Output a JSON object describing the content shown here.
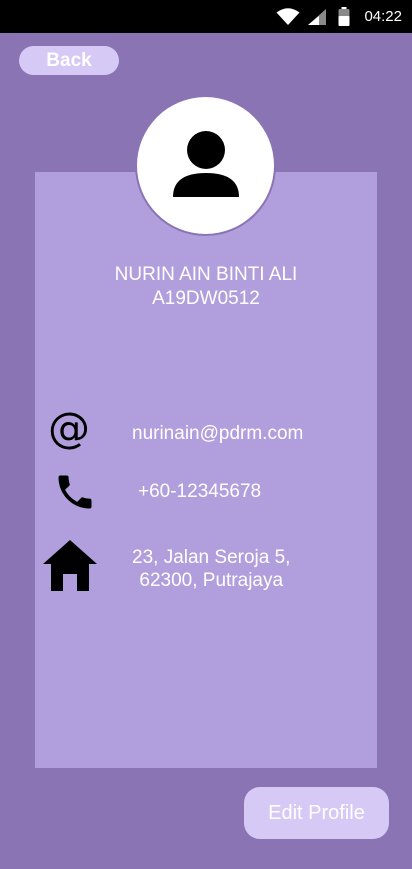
{
  "status_bar": {
    "time": "04:22"
  },
  "header": {
    "back_label": "Back"
  },
  "profile": {
    "name": "NURIN AIN BINTI ALI",
    "id": "A19DW0512",
    "email": "nurinain@pdrm.com",
    "phone": "+60-12345678",
    "address_line1": "23, Jalan Seroja 5,",
    "address_line2": "62300, Putrajaya"
  },
  "actions": {
    "edit_profile_label": "Edit Profile"
  },
  "icons": {
    "avatar": "person-icon",
    "email": "at-sign-icon",
    "phone": "phone-icon",
    "address": "home-icon"
  },
  "colors": {
    "background": "#8b74b3",
    "card": "#b19edc",
    "button": "#d6c9f6",
    "text": "#ffffff"
  }
}
